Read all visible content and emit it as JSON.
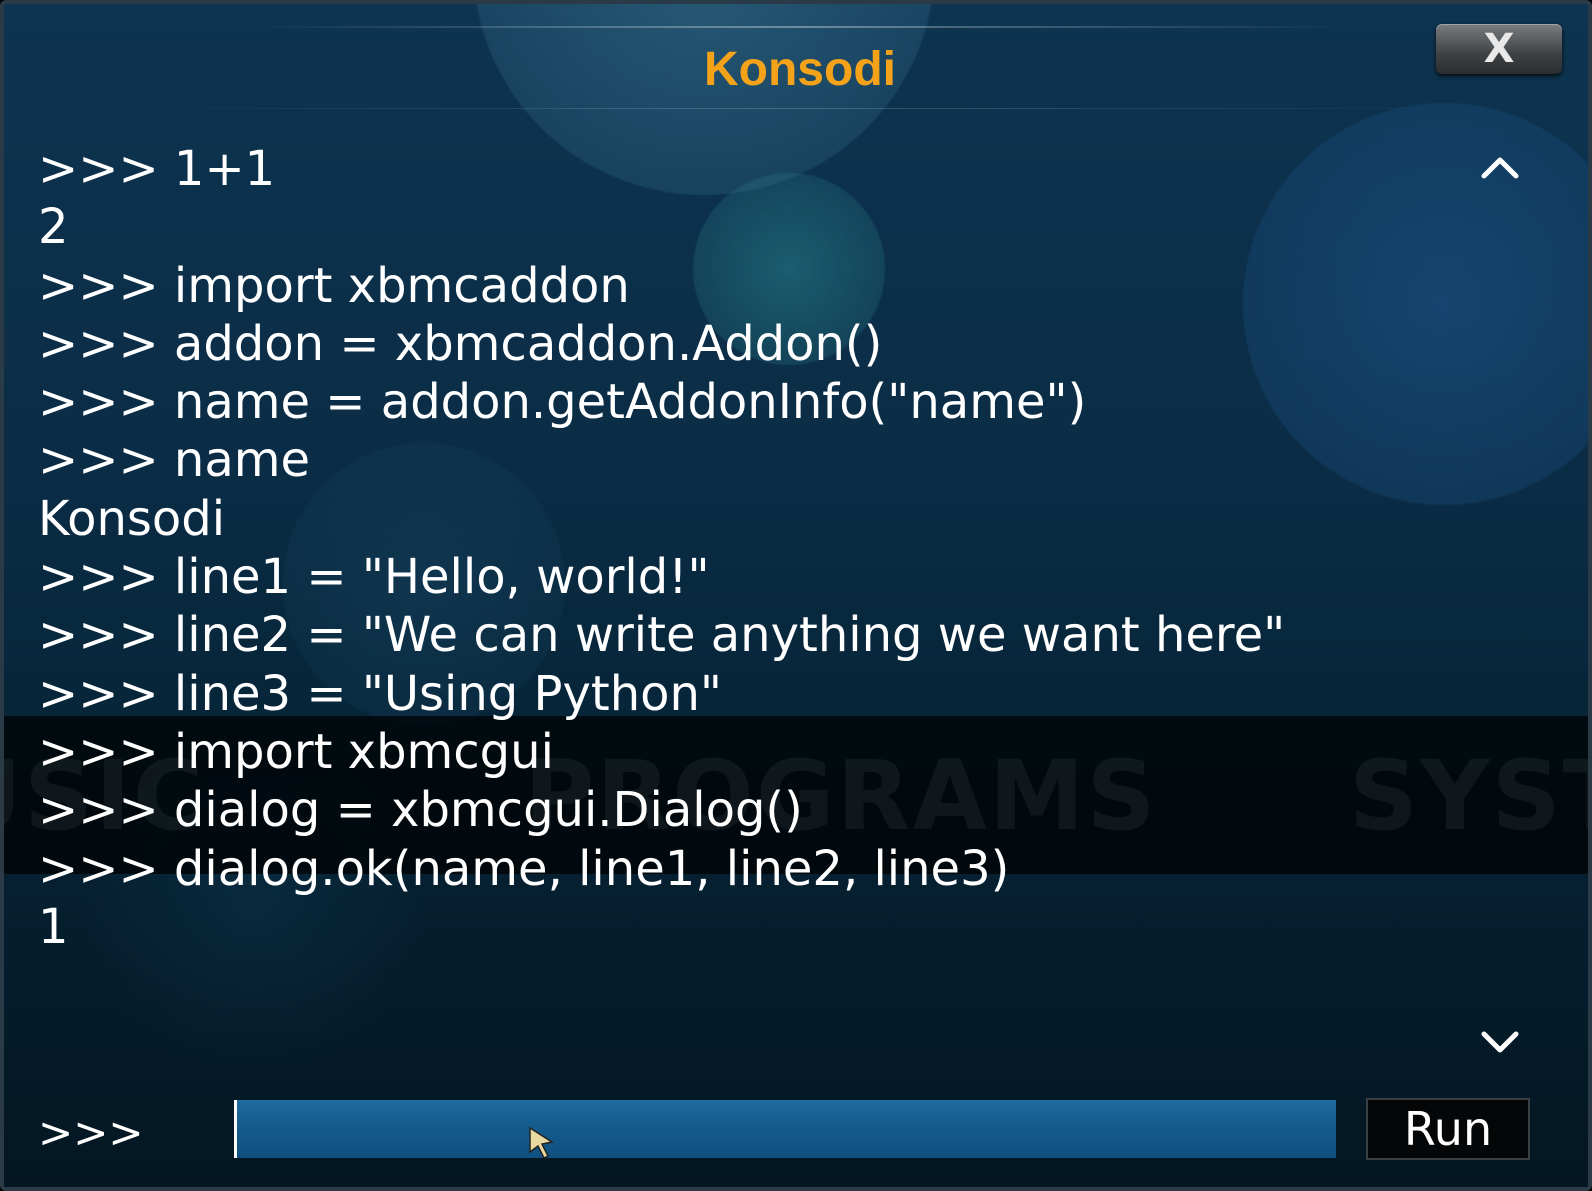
{
  "dialog": {
    "title": "Konsodi",
    "close_label": "X"
  },
  "background": {
    "menu_text_left": "USIC",
    "menu_text_mid": "PROGRAMS",
    "menu_text_right": "SYST"
  },
  "console": {
    "lines": [
      ">>> 1+1",
      "2",
      ">>> import xbmcaddon",
      ">>> addon = xbmcaddon.Addon()",
      ">>> name = addon.getAddonInfo(\"name\")",
      ">>> name",
      "Konsodi",
      ">>> line1 = \"Hello, world!\"",
      ">>> line2 = \"We can write anything we want here\"",
      ">>> line3 = \"Using Python\"",
      ">>> import xbmcgui",
      ">>> dialog = xbmcgui.Dialog()",
      ">>> dialog.ok(name, line1, line2, line3)",
      "1"
    ],
    "scroll_up_icon": "chevron-up-icon",
    "scroll_down_icon": "chevron-down-icon"
  },
  "input": {
    "prompt": ">>>",
    "value": "",
    "run_label": "Run"
  },
  "colors": {
    "title": "#f5a21b",
    "input_bg": "#145c8c"
  }
}
